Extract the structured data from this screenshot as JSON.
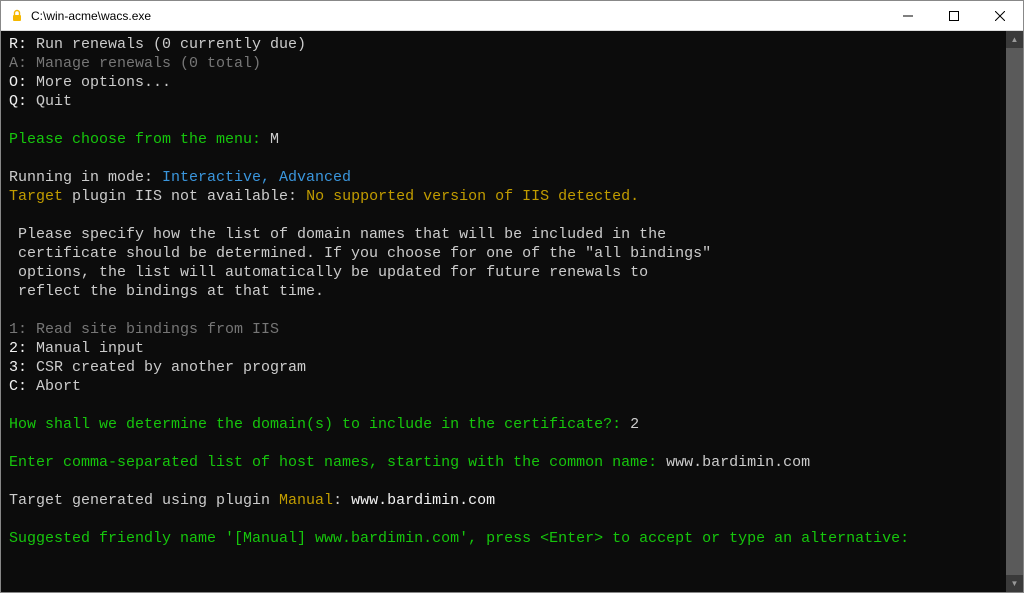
{
  "window": {
    "title": "C:\\win-acme\\wacs.exe"
  },
  "menu": {
    "R_key": "R:",
    "R_text": " Run renewals (0 currently due)",
    "A_key": "A:",
    "A_text": " Manage renewals (0 total)",
    "O_key": "O:",
    "O_text": " More options...",
    "Q_key": "Q:",
    "Q_text": " Quit"
  },
  "prompt1": {
    "label": "Please choose from the menu: ",
    "input": "M"
  },
  "mode": {
    "prefix": "Running in mode: ",
    "value": "Interactive, Advanced"
  },
  "target_warn": {
    "t1": "Target",
    "t2": " plugin IIS not available: ",
    "t3": "No supported version of IIS detected."
  },
  "help": {
    "l1": " Please specify how the list of domain names that will be included in the",
    "l2": " certificate should be determined. If you choose for one of the \"all bindings\"",
    "l3": " options, the list will automatically be updated for future renewals to",
    "l4": " reflect the bindings at that time."
  },
  "opts": {
    "o1_key": "1:",
    "o1_text": " Read site bindings from IIS",
    "o2_key": "2:",
    "o2_text": " Manual input",
    "o3_key": "3:",
    "o3_text": " CSR created by another program",
    "oC_key": "C:",
    "oC_text": " Abort"
  },
  "prompt2": {
    "label": "How shall we determine the domain(s) to include in the certificate?: ",
    "input": "2"
  },
  "prompt3": {
    "label": "Enter comma-separated list of host names, starting with the common name: ",
    "input": "www.bardimin.com"
  },
  "target_gen": {
    "t1": "Target generated using plugin ",
    "t2": "Manual",
    "t3": ": ",
    "t4": "www.bardimin.com"
  },
  "friendly": "Suggested friendly name '[Manual] www.bardimin.com', press <Enter> to accept or type an alternative:"
}
